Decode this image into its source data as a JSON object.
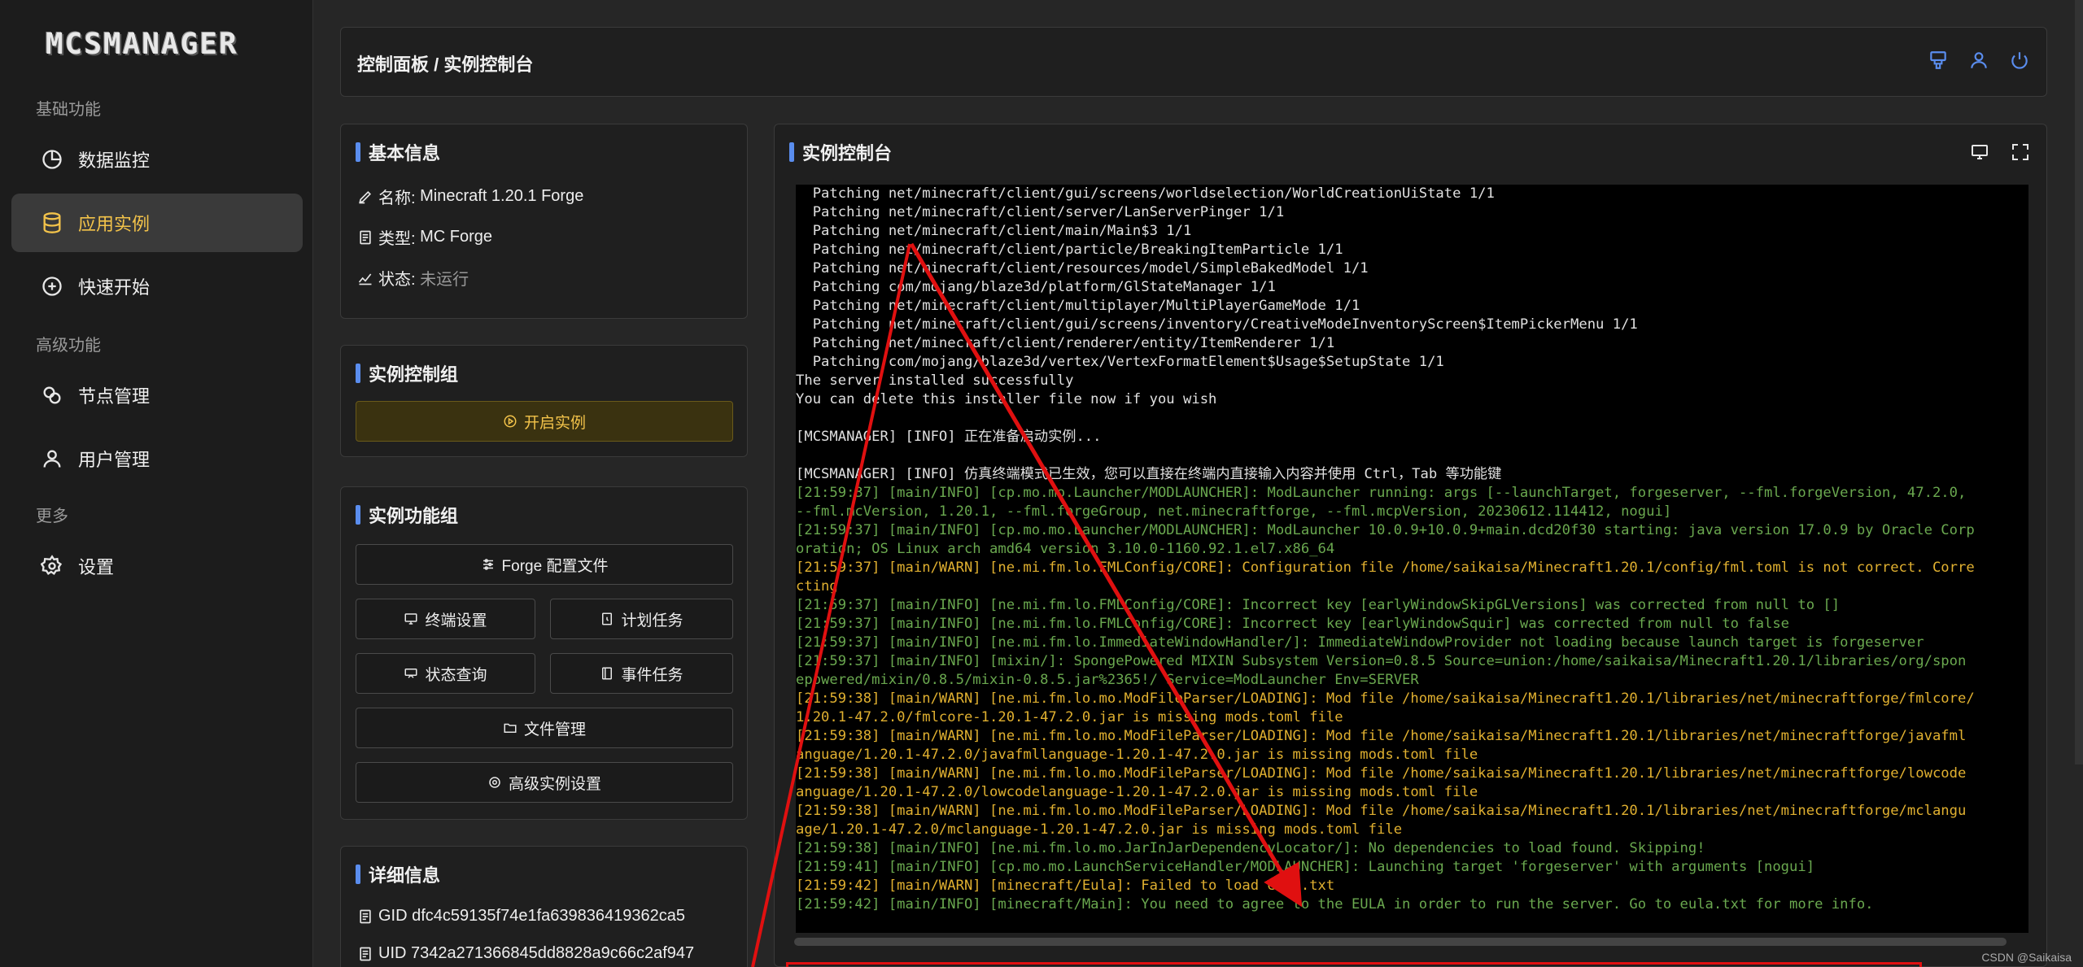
{
  "brand": {
    "logo_text": "MCSMANAGER"
  },
  "sidebar": {
    "groups": [
      "基础功能",
      "高级功能",
      "更多"
    ],
    "items": [
      {
        "label": "数据监控",
        "icon": "pie-chart-icon"
      },
      {
        "label": "应用实例",
        "icon": "database-icon",
        "active": true
      },
      {
        "label": "快速开始",
        "icon": "plus-circle-icon"
      },
      {
        "label": "节点管理",
        "icon": "nodes-icon"
      },
      {
        "label": "用户管理",
        "icon": "user-icon"
      },
      {
        "label": "设置",
        "icon": "gear-icon"
      }
    ]
  },
  "header": {
    "breadcrumb": "控制面板 / 实例控制台"
  },
  "basic_info": {
    "title": "基本信息",
    "name_label": "名称:",
    "name_value": "Minecraft 1.20.1 Forge",
    "type_label": "类型:",
    "type_value": "MC Forge",
    "status_label": "状态:",
    "status_value": "未运行"
  },
  "control_group": {
    "title": "实例控制组",
    "start_label": "开启实例"
  },
  "function_group": {
    "title": "实例功能组",
    "forge_config": "Forge 配置文件",
    "terminal_settings": "终端设置",
    "scheduled_tasks": "计划任务",
    "status_query": "状态查询",
    "event_tasks": "事件任务",
    "file_manager": "文件管理",
    "advanced_settings": "高级实例设置"
  },
  "details": {
    "title": "详细信息",
    "gid_label": "GID",
    "gid_value": "dfc4c59135f74e1fa639836419362ca5",
    "uid_label": "UID",
    "uid_value": "7342a271366845dd8828a9c66c2af947"
  },
  "console_panel": {
    "title": "实例控制台",
    "lines": [
      {
        "t": "  Patching net/minecraft/client/gui/screens/worldselection/WorldCreationUiState 1/1",
        "c": "w"
      },
      {
        "t": "  Patching net/minecraft/client/server/LanServerPinger 1/1",
        "c": "w"
      },
      {
        "t": "  Patching net/minecraft/client/main/Main$3 1/1",
        "c": "w"
      },
      {
        "t": "  Patching net/minecraft/client/particle/BreakingItemParticle 1/1",
        "c": "w"
      },
      {
        "t": "  Patching net/minecraft/client/resources/model/SimpleBakedModel 1/1",
        "c": "w"
      },
      {
        "t": "  Patching com/mojang/blaze3d/platform/GlStateManager 1/1",
        "c": "w"
      },
      {
        "t": "  Patching net/minecraft/client/multiplayer/MultiPlayerGameMode 1/1",
        "c": "w"
      },
      {
        "t": "  Patching net/minecraft/client/gui/screens/inventory/CreativeModeInventoryScreen$ItemPickerMenu 1/1",
        "c": "w"
      },
      {
        "t": "  Patching net/minecraft/client/renderer/entity/ItemRenderer 1/1",
        "c": "w"
      },
      {
        "t": "  Patching com/mojang/blaze3d/vertex/VertexFormatElement$Usage$SetupState 1/1",
        "c": "w"
      },
      {
        "t": "The server installed successfully",
        "c": "w"
      },
      {
        "t": "You can delete this installer file now if you wish",
        "c": "w"
      },
      {
        "t": "",
        "c": "w"
      },
      {
        "t": "[MCSMANAGER] [INFO] 正在准备启动实例...",
        "c": "w"
      },
      {
        "t": "",
        "c": "w"
      },
      {
        "t": "[MCSMANAGER] [INFO] 仿真终端模式已生效，您可以直接在终端内直接输入内容并使用 Ctrl，Tab 等功能键",
        "c": "w"
      },
      {
        "t": "[21:59:37] [main/INFO] [cp.mo.mo.Launcher/MODLAUNCHER]: ModLauncher running: args [--launchTarget, forgeserver, --fml.forgeVersion, 47.2.0,",
        "c": "g"
      },
      {
        "t": "--fml.mcVersion, 1.20.1, --fml.forgeGroup, net.minecraftforge, --fml.mcpVersion, 20230612.114412, nogui]",
        "c": "g"
      },
      {
        "t": "[21:59:37] [main/INFO] [cp.mo.mo.Launcher/MODLAUNCHER]: ModLauncher 10.0.9+10.0.9+main.dcd20f30 starting: java version 17.0.9 by Oracle Corp",
        "c": "g"
      },
      {
        "t": "oration; OS Linux arch amd64 version 3.10.0-1160.92.1.el7.x86_64",
        "c": "g"
      },
      {
        "t": "[21:59:37] [main/WARN] [ne.mi.fm.lo.FMLConfig/CORE]: Configuration file /home/saikaisa/Minecraft1.20.1/config/fml.toml is not correct. Corre",
        "c": "y"
      },
      {
        "t": "cting",
        "c": "y"
      },
      {
        "t": "[21:59:37] [main/INFO] [ne.mi.fm.lo.FMLConfig/CORE]: Incorrect key [earlyWindowSkipGLVersions] was corrected from null to []",
        "c": "g"
      },
      {
        "t": "[21:59:37] [main/INFO] [ne.mi.fm.lo.FMLConfig/CORE]: Incorrect key [earlyWindowSquir] was corrected from null to false",
        "c": "g"
      },
      {
        "t": "[21:59:37] [main/INFO] [ne.mi.fm.lo.ImmediateWindowHandler/]: ImmediateWindowProvider not loading because launch target is forgeserver",
        "c": "g"
      },
      {
        "t": "[21:59:37] [main/INFO] [mixin/]: SpongePowered MIXIN Subsystem Version=0.8.5 Source=union:/home/saikaisa/Minecraft1.20.1/libraries/org/spon",
        "c": "g"
      },
      {
        "t": "epowered/mixin/0.8.5/mixin-0.8.5.jar%2365!/ Service=ModLauncher Env=SERVER",
        "c": "g"
      },
      {
        "t": "[21:59:38] [main/WARN] [ne.mi.fm.lo.mo.ModFileParser/LOADING]: Mod file /home/saikaisa/Minecraft1.20.1/libraries/net/minecraftforge/fmlcore/",
        "c": "y"
      },
      {
        "t": "1.20.1-47.2.0/fmlcore-1.20.1-47.2.0.jar is missing mods.toml file",
        "c": "y"
      },
      {
        "t": "[21:59:38] [main/WARN] [ne.mi.fm.lo.mo.ModFileParser/LOADING]: Mod file /home/saikaisa/Minecraft1.20.1/libraries/net/minecraftforge/javafml",
        "c": "y"
      },
      {
        "t": "anguage/1.20.1-47.2.0/javafmllanguage-1.20.1-47.2.0.jar is missing mods.toml file",
        "c": "y"
      },
      {
        "t": "[21:59:38] [main/WARN] [ne.mi.fm.lo.mo.ModFileParser/LOADING]: Mod file /home/saikaisa/Minecraft1.20.1/libraries/net/minecraftforge/lowcode",
        "c": "y"
      },
      {
        "t": "anguage/1.20.1-47.2.0/lowcodelanguage-1.20.1-47.2.0.jar is missing mods.toml file",
        "c": "y"
      },
      {
        "t": "[21:59:38] [main/WARN] [ne.mi.fm.lo.mo.ModFileParser/LOADING]: Mod file /home/saikaisa/Minecraft1.20.1/libraries/net/minecraftforge/mclangu",
        "c": "y"
      },
      {
        "t": "age/1.20.1-47.2.0/mclanguage-1.20.1-47.2.0.jar is missing mods.toml file",
        "c": "y"
      },
      {
        "t": "[21:59:38] [main/INFO] [ne.mi.fm.lo.mo.JarInJarDependencyLocator/]: No dependencies to load found. Skipping!",
        "c": "g"
      },
      {
        "t": "[21:59:41] [main/INFO] [cp.mo.mo.LaunchServiceHandler/MODLAUNCHER]: Launching target 'forgeserver' with arguments [nogui]",
        "c": "g"
      },
      {
        "t": "[21:59:42] [main/WARN] [minecraft/Eula]: Failed to load eula.txt",
        "c": "y"
      },
      {
        "t": "[21:59:42] [main/INFO] [minecraft/Main]: You need to agree to the EULA in order to run the server. Go to eula.txt for more info.",
        "c": "g"
      }
    ]
  },
  "watermark": "CSDN @Saikaisa",
  "colors": {
    "accent": "#5a8dee",
    "active": "#f3c34a",
    "annotation": "#e01010"
  }
}
